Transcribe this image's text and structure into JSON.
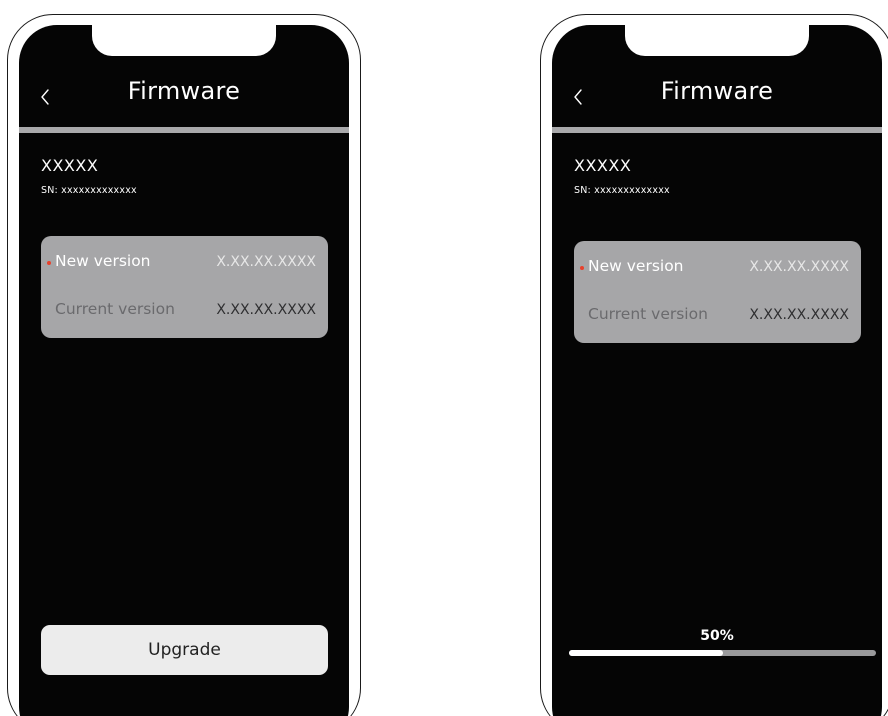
{
  "screens": [
    {
      "header": {
        "title": "Firmware",
        "back_icon": "chevron-left-icon"
      },
      "device": {
        "name": "XXXXX",
        "sn": "SN: xxxxxxxxxxxxx"
      },
      "versions": {
        "new_label": "New version",
        "new_value": "X.XX.XX.XXXX",
        "current_label": "Current version",
        "current_value": "X.XX.XX.XXXX"
      },
      "action": {
        "upgrade_label": "Upgrade"
      }
    },
    {
      "header": {
        "title": "Firmware",
        "back_icon": "chevron-left-icon"
      },
      "device": {
        "name": "XXXXX",
        "sn": "SN: xxxxxxxxxxxxx"
      },
      "versions": {
        "new_label": "New version",
        "new_value": "X.XX.XX.XXXX",
        "current_label": "Current version",
        "current_value": "X.XX.XX.XXXX"
      },
      "progress": {
        "label": "50%",
        "fraction": 0.5
      }
    }
  ],
  "colors": {
    "screen_background": "#050505",
    "divider": "#a9a9ab",
    "card_background": "#a6a6a8",
    "new_indicator": "#e8412c",
    "button_background": "#ececec",
    "progress_fill": "#ffffff",
    "progress_track": "#9a9a9c"
  }
}
